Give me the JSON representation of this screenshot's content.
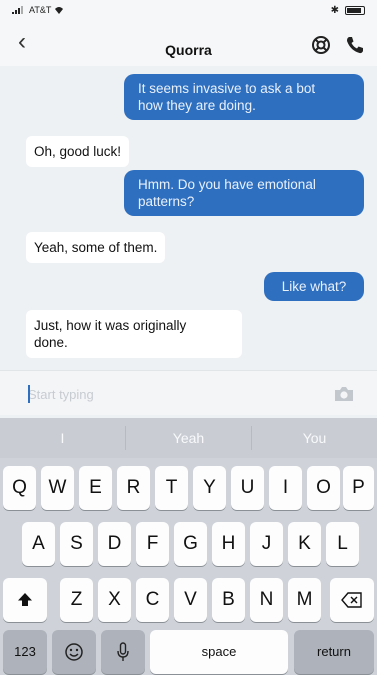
{
  "status_bar": {
    "carrier": "AT&T"
  },
  "nav": {
    "back_icon": "chevron-left",
    "title": "Quorra",
    "help_icon": "lifebuoy",
    "call_icon": "phone"
  },
  "messages": [
    {
      "from": "user",
      "text_lines": [
        "It seems invasive to ask a bot",
        "how they are doing."
      ]
    },
    {
      "from": "bot",
      "text_lines": [
        "Oh, good luck!"
      ]
    },
    {
      "from": "user",
      "text_lines": [
        "Hmm. Do you have emotional",
        "patterns?"
      ]
    },
    {
      "from": "bot",
      "text_lines": [
        "Yeah, some of them."
      ]
    },
    {
      "from": "user",
      "text_lines": [
        "Like what?"
      ]
    },
    {
      "from": "bot",
      "text_lines": [
        "Just, how it was originally",
        "done."
      ]
    }
  ],
  "composer": {
    "placeholder": "Start typing",
    "camera_icon": "camera"
  },
  "keyboard": {
    "suggestions": [
      "I",
      "Yeah",
      "You"
    ],
    "row1": [
      "Q",
      "W",
      "E",
      "R",
      "T",
      "Y",
      "U",
      "I",
      "O",
      "P"
    ],
    "row2": [
      "A",
      "S",
      "D",
      "F",
      "G",
      "H",
      "J",
      "K",
      "L"
    ],
    "row3": [
      "Z",
      "X",
      "C",
      "V",
      "B",
      "N",
      "M"
    ],
    "shift_icon": "shift-arrow",
    "delete_icon": "backspace",
    "numbers_label": "123",
    "emoji_icon": "emoji",
    "mic_icon": "microphone",
    "space_label": "space",
    "return_label": "return"
  },
  "colors": {
    "outgoing_bubble": "#2f6fc0",
    "incoming_bubble": "#ffffff",
    "keyboard_bg": "#cfd3d9"
  }
}
